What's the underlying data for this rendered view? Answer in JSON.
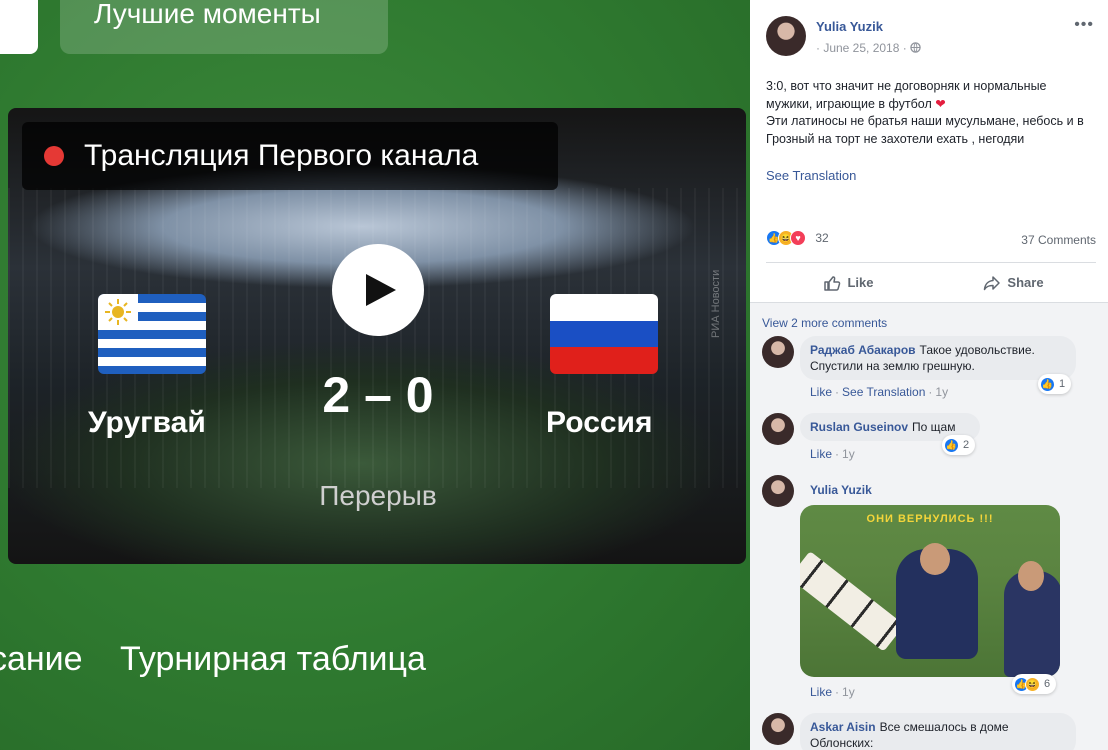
{
  "photo": {
    "best_moments_label": "Лучшие моменты",
    "broadcast_label": "Трансляция Первого канала",
    "team_left": "Уругвай",
    "team_right": "Россия",
    "score": "2 – 0",
    "status": "Перерыв",
    "watermark": "РИА Новости",
    "tabs": [
      "сание",
      "Турнирная таблица"
    ]
  },
  "post": {
    "author": "Yulia Yuzik",
    "date": "· June 25, 2018 ·",
    "text_line1": "3:0, вот что значит не договорняк и нормальные мужики, играющие в футбол ",
    "heart": "❤",
    "text_line2": "Эти латиносы не братья наши мусульмане, небось и в Грозный на торт не захотели ехать , негодяи",
    "see_translation": "See Translation",
    "reaction_count": "32",
    "comments_count": "37 Comments",
    "like_label": "Like",
    "share_label": "Share"
  },
  "comments_section": {
    "view_more": "View 2 more comments",
    "items": [
      {
        "name": "Раджаб Абакаров",
        "text": "Такое удовольствие. Спустили на землю грешную.",
        "like": "Like",
        "translate": "See Translation",
        "time": "1y",
        "reactions": "1"
      },
      {
        "name": "Ruslan Guseinov",
        "text": "По щам",
        "like": "Like",
        "time": "1y",
        "reactions": "2"
      },
      {
        "name": "Yulia Yuzik",
        "meme_caption": "ОНИ ВЕРНУЛИСЬ !!!",
        "like": "Like",
        "time": "1y",
        "reactions": "6"
      },
      {
        "name": "Askar Aisin",
        "text": "Все смешалось в доме Облонских:"
      }
    ]
  },
  "colors": {
    "fb_link": "#385898",
    "like_blue": "#1877f2",
    "love_red": "#f33e58",
    "haha_yellow": "#f7b125",
    "pitch_green": "#2f7a30",
    "live_red": "#e53935"
  }
}
